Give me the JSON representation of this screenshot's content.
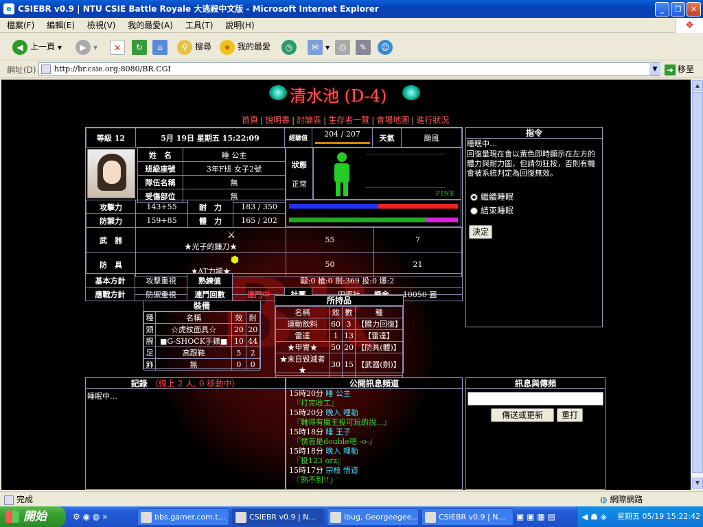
{
  "window": {
    "title": "CSIEBR v0.9 | NTU CSIE Battle Royale 大逃殺中文版 - Microsoft Internet Explorer"
  },
  "menu": [
    "檔案(F)",
    "編輯(E)",
    "檢視(V)",
    "我的最愛(A)",
    "工具(T)",
    "說明(H)"
  ],
  "toolbar": {
    "back": "上一頁",
    "search": "搜尋",
    "favorites": "我的最愛"
  },
  "address": {
    "label": "網址(D)",
    "url": "http://br.csie.org:8080/BR.CGI",
    "go": "移至"
  },
  "page": {
    "place": "清水池 (D-4)",
    "nav": [
      "首頁",
      "說明書",
      "討論區",
      "生存者一覽",
      "會場地圖",
      "進行狀況"
    ],
    "level": "等級 12",
    "datetime": "5月 19日 星期五 15:22:09",
    "exp_label": "經驗值",
    "exp": "204 / 207",
    "weather_label": "天氣",
    "weather": "颱風",
    "name_label": "姓　名",
    "name": "睡 公主",
    "class_label": "班級座號",
    "class": "3年F班 女子2號",
    "team_label": "隊伍名稱",
    "team": "無",
    "injury_label": "受傷部位",
    "injury": "無",
    "status_label": "狀態",
    "status": "正常",
    "fine": "FINE",
    "atk_label": "攻擊力",
    "atk": "143+55",
    "hp_label": "耐　力",
    "hp": "183 / 350",
    "def_label": "防禦力",
    "def": "159+85",
    "sp_label": "體　力",
    "sp": "165 / 202",
    "weapon_label": "武　器",
    "weapon": "★光子的鐮刀★",
    "weapon_val1": "55",
    "weapon_val2": "7",
    "armor_label": "防　具",
    "armor": "★AT力場★",
    "armor_val1": "50",
    "armor_val2": "21",
    "basic_label": "基本方針",
    "basic": "攻擊重視",
    "skill_label": "熟練值",
    "skill": "毆:0 槍:0 劍:369 投:0 爆:2",
    "battle_label": "應戰方針",
    "battle": "防禦重視",
    "club_status_label": "連鬥回數",
    "club_status": "連鬥中",
    "club_label": "社團",
    "club": "田徑社",
    "money_label": "資金",
    "money": "10050 圓",
    "equip_title": "裝備",
    "equip_cols": [
      "種",
      "名稱",
      "效",
      "耐"
    ],
    "equip": [
      [
        "頭",
        "☆虎紋面具☆",
        "20",
        "20"
      ],
      [
        "腕",
        "■G-SHOCK手錶■",
        "10",
        "44"
      ],
      [
        "足",
        "高跟鞋",
        "5",
        "2"
      ],
      [
        "飾",
        "無",
        "0",
        "0"
      ]
    ],
    "items_title": "所持品",
    "items_cols": [
      "名稱",
      "效",
      "數",
      "種"
    ],
    "items": [
      [
        "運動飲料",
        "60",
        "3",
        "【體力回復】"
      ],
      [
        "雷達",
        "1",
        "13",
        "【雷達】"
      ],
      [
        "★甲冑★",
        "50",
        "20",
        "【防具(體)】"
      ],
      [
        "★末日毀滅者★",
        "30",
        "15",
        "【武器(劍)】"
      ],
      [
        "無",
        "0",
        "0",
        "【無】"
      ]
    ],
    "cmd_title": "指令",
    "cmd_text1": "睡眠中…",
    "cmd_text2": "回復量現在會以黃色即時顯示在左方的體力與耐力圖，但請勿狂按，否則有機會被系統判定為回復無效。",
    "cmd_opt1": "繼續睡眠",
    "cmd_opt2": "結束睡眠",
    "cmd_btn": "決定",
    "log_title": "記錄",
    "log_sub": "（線上 2 人, 0 移動中）",
    "log_text": "睡眠中…",
    "chat_title": "公開訊息頻道",
    "chat": [
      {
        "time": "15時20分",
        "who": "睡 公主",
        "msg": "『打完收工』"
      },
      {
        "time": "15時20分",
        "who": "晚入 哩勒",
        "msg": "『難得有魔王投可玩的說...』"
      },
      {
        "time": "15時18分",
        "who": "睡 王子",
        "msg": "『愣首是double吧 -o-』"
      },
      {
        "time": "15時18分",
        "who": "晚入 哩勒",
        "msg": "『投123 orz』"
      },
      {
        "time": "15時17分",
        "who": "宗枝 悟道",
        "msg": "『熟不到!!』"
      }
    ],
    "msg_title": "訊息與傳頻",
    "msg_send": "傳送或更新",
    "msg_reset": "重打"
  },
  "status": {
    "text": "完成",
    "zone": "網際網路"
  },
  "taskbar": {
    "start": "開始",
    "tasks": [
      "bbs.gamer.com.t...",
      "CSIEBR v0.9 | N...",
      "ibug, Georgeegee...",
      "CSIEBR v0.9 | N..."
    ],
    "clock": "星期五 05/19 15:22:42"
  }
}
